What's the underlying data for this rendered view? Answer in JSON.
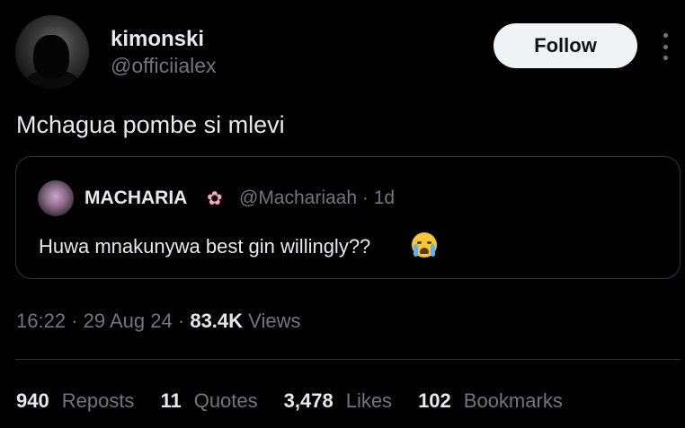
{
  "author": {
    "display_name": "kimonski",
    "handle": "@officiialex"
  },
  "follow_label": "Follow",
  "tweet_text": "Mchagua pombe si mlevi",
  "quoted": {
    "display_name": "MACHARIA",
    "name_emoji": "✿",
    "handle_time": "@Machariaah · 1d",
    "text": "Huwa mnakunywa best gin willingly??",
    "emoji": "loudly-crying-face-emoji"
  },
  "meta": {
    "time": "16:22",
    "date": "29 Aug 24",
    "views_count": "83.4K",
    "views_label": "Views",
    "separator": "·"
  },
  "stats": [
    {
      "count": "940",
      "label": "Reposts"
    },
    {
      "count": "11",
      "label": "Quotes"
    },
    {
      "count": "3,478",
      "label": "Likes"
    },
    {
      "count": "102",
      "label": "Bookmarks"
    }
  ],
  "colors": {
    "background": "#000000",
    "primary_text": "#e7e9ea",
    "secondary_text": "#71767b",
    "border": "#2f3336",
    "follow_bg": "#eff3f4"
  }
}
